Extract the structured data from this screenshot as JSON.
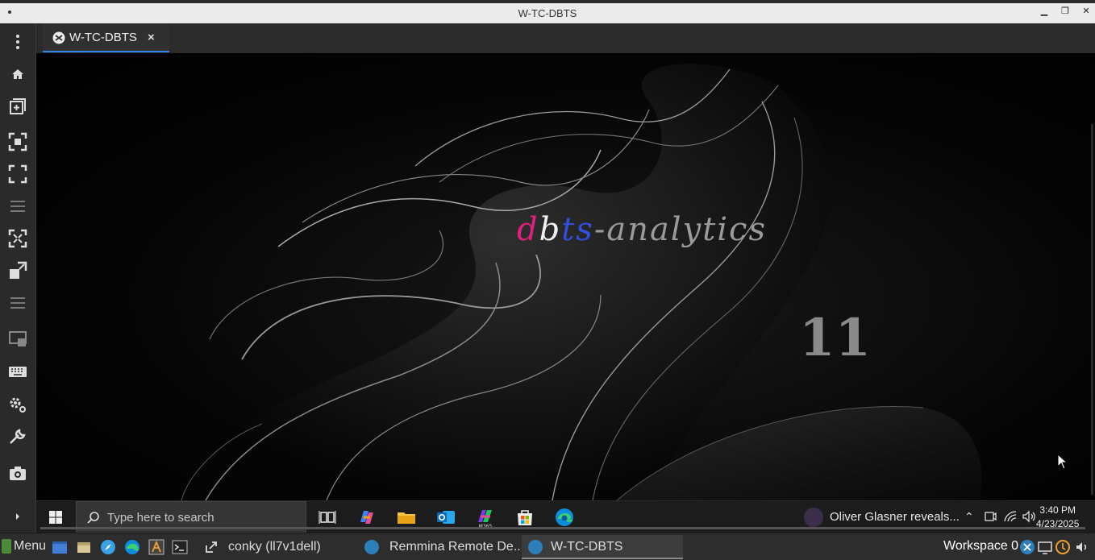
{
  "window": {
    "title": "W-TC-DBTS"
  },
  "tab": {
    "label": "W-TC-DBTS",
    "close": "×"
  },
  "wallpaper": {
    "logo": {
      "d": "d",
      "b": "b",
      "t": "t",
      "s": "s",
      "rest": "-analytics"
    },
    "badge": "11"
  },
  "win_taskbar": {
    "search_placeholder": "Type here to search",
    "news": "Oliver Glasner reveals...",
    "time": "3:40 PM",
    "date": "4/23/2025"
  },
  "panel": {
    "menu": "Menu",
    "tasks": [
      {
        "label": "conky (ll7v1dell)"
      },
      {
        "label": "Remmina Remote De..."
      },
      {
        "label": "W-TC-DBTS"
      }
    ],
    "workspace": "Workspace 0"
  },
  "colors": {
    "tab_accent": "#3584e4",
    "logo_pink": "#e0207f",
    "logo_blue": "#3050e0"
  }
}
